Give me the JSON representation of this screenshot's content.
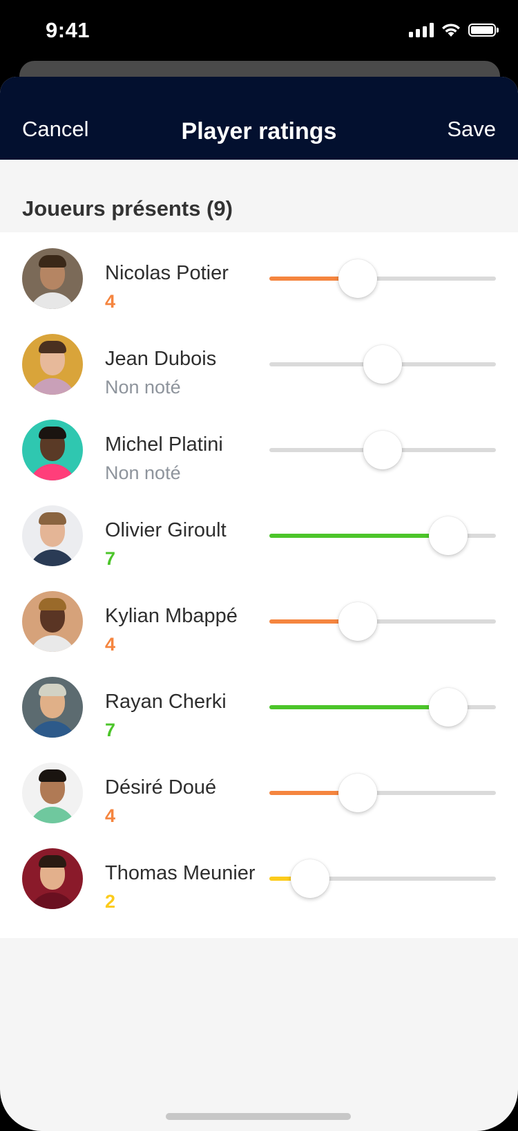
{
  "status_bar": {
    "time": "9:41"
  },
  "nav": {
    "cancel_label": "Cancel",
    "title": "Player ratings",
    "save_label": "Save"
  },
  "section": {
    "title": "Joueurs présents (9)"
  },
  "colors": {
    "orange": "#f5853f",
    "green": "#4cc52a",
    "yellow": "#fccb1b",
    "unrated": "#8e949c",
    "navbar": "#03102f"
  },
  "players": [
    {
      "name": "Nicolas Potier",
      "score_text": "4",
      "rating": 4,
      "rated": true,
      "color": "#f5853f",
      "fill_ratio": 0.39,
      "avatar": {
        "bg": "#7b6a58",
        "skin": "#b58563",
        "hair": "#3a2818",
        "shirt": "#e7e7e7"
      }
    },
    {
      "name": "Jean Dubois",
      "score_text": "Non noté",
      "rating": null,
      "rated": false,
      "color": "#dadada",
      "fill_ratio": 0.5,
      "avatar": {
        "bg": "#d9a43a",
        "skin": "#e7b99a",
        "hair": "#4a3020",
        "shirt": "#c9a0b8"
      }
    },
    {
      "name": "Michel Platini",
      "score_text": "Non noté",
      "rating": null,
      "rated": false,
      "color": "#dadada",
      "fill_ratio": 0.5,
      "avatar": {
        "bg": "#2fc7b0",
        "skin": "#5a3a26",
        "hair": "#1a1410",
        "shirt": "#ff3e7a"
      }
    },
    {
      "name": "Olivier Giroult",
      "score_text": "7",
      "rating": 7,
      "rated": true,
      "color": "#4cc52a",
      "fill_ratio": 0.79,
      "avatar": {
        "bg": "#ecedf0",
        "skin": "#e4b596",
        "hair": "#8a6440",
        "shirt": "#2a3b55"
      }
    },
    {
      "name": "Kylian Mbappé",
      "score_text": "4",
      "rating": 4,
      "rated": true,
      "color": "#f5853f",
      "fill_ratio": 0.39,
      "avatar": {
        "bg": "#d6a27a",
        "skin": "#5a3524",
        "hair": "#9a6a2a",
        "shirt": "#e9e9e9"
      }
    },
    {
      "name": "Rayan Cherki",
      "score_text": "7",
      "rating": 7,
      "rated": true,
      "color": "#4cc52a",
      "fill_ratio": 0.79,
      "avatar": {
        "bg": "#5c6b70",
        "skin": "#e0b088",
        "hair": "#d2d2c4",
        "shirt": "#2d5a8a"
      }
    },
    {
      "name": "Désiré Doué",
      "score_text": "4",
      "rating": 4,
      "rated": true,
      "color": "#f5853f",
      "fill_ratio": 0.39,
      "avatar": {
        "bg": "#f2f2f2",
        "skin": "#b07a55",
        "hair": "#1a1410",
        "shirt": "#6fc89e"
      }
    },
    {
      "name": "Thomas Meunier",
      "score_text": "2",
      "rating": 2,
      "rated": true,
      "color": "#fccb1b",
      "fill_ratio": 0.18,
      "avatar": {
        "bg": "#8a1a2a",
        "skin": "#e3b08c",
        "hair": "#2a1a12",
        "shirt": "#6a1020"
      }
    }
  ]
}
